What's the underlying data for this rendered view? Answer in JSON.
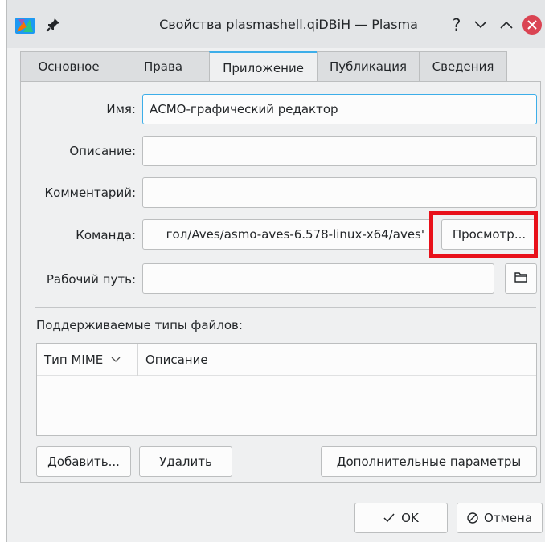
{
  "titlebar": {
    "title": "Свойства plasmashell.qiDBiH — Plasma",
    "help_symbol": "?",
    "app_icon": "plasma-app-icon",
    "pin_icon": "pin-icon"
  },
  "tabs": [
    {
      "label": "Основное",
      "active": false
    },
    {
      "label": "Права",
      "active": false
    },
    {
      "label": "Приложение",
      "active": true
    },
    {
      "label": "Публикация",
      "active": false
    },
    {
      "label": "Сведения",
      "active": false
    }
  ],
  "form": {
    "name_label": "Имя:",
    "name_value": "АСМО-графический редактор",
    "description_label": "Описание:",
    "description_value": "",
    "comment_label": "Комментарий:",
    "comment_value": "",
    "command_label": "Команда:",
    "command_value": "гол/Aves/asmo-aves-6.578-linux-x64/aves'",
    "browse_label": "Просмотр...",
    "workdir_label": "Рабочий путь:",
    "workdir_value": ""
  },
  "mime": {
    "section_label": "Поддерживаемые типы файлов:",
    "col_mime": "Тип MIME",
    "col_description": "Описание",
    "rows": []
  },
  "actions": {
    "add_label": "Добавить...",
    "remove_label": "Удалить",
    "advanced_label": "Дополнительные параметры"
  },
  "dialog": {
    "ok_label": "OK",
    "cancel_label": "Отмена"
  },
  "colors": {
    "accent": "#3daee9",
    "highlight": "#e8101a",
    "close": "#da4453"
  }
}
